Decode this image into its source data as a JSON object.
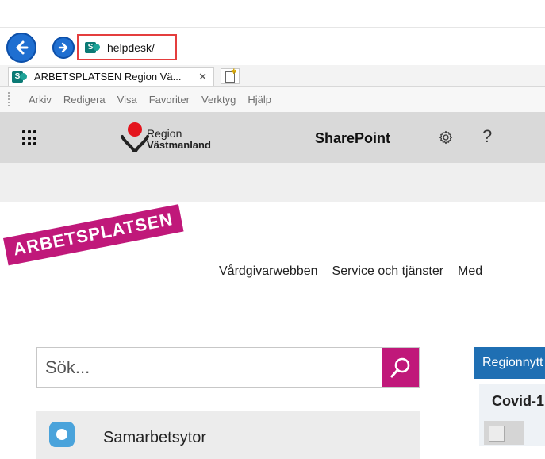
{
  "browser": {
    "address": "helpdesk/",
    "tab_title": "ARBETSPLATSEN Region Vä...",
    "tab_close": "✕",
    "menu": [
      "Arkiv",
      "Redigera",
      "Visa",
      "Favoriter",
      "Verktyg",
      "Hjälp"
    ]
  },
  "suitebar": {
    "logo_line1": "Region",
    "logo_line2": "Västmanland",
    "app_name": "SharePoint",
    "help": "?"
  },
  "site": {
    "brand": "ARBETSPLATSEN",
    "nav": [
      "Vårdgivarwebben",
      "Service och tjänster",
      "Med"
    ]
  },
  "search": {
    "placeholder": "Sök..."
  },
  "news": {
    "header": "Regionnytt",
    "title": "Covid-1"
  },
  "links": {
    "collab": "Samarbetsytor"
  },
  "colors": {
    "brand": "#c0187a",
    "nav_blue": "#1f6fd1",
    "highlight": "#e43d3d",
    "news_blue": "#1f6fb3"
  }
}
